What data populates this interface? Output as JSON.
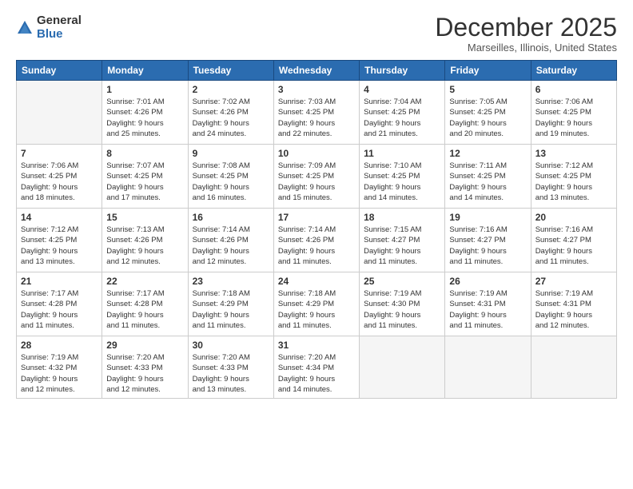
{
  "logo": {
    "general": "General",
    "blue": "Blue"
  },
  "header": {
    "title": "December 2025",
    "location": "Marseilles, Illinois, United States"
  },
  "weekdays": [
    "Sunday",
    "Monday",
    "Tuesday",
    "Wednesday",
    "Thursday",
    "Friday",
    "Saturday"
  ],
  "weeks": [
    [
      {
        "day": "",
        "info": ""
      },
      {
        "day": "1",
        "info": "Sunrise: 7:01 AM\nSunset: 4:26 PM\nDaylight: 9 hours\nand 25 minutes."
      },
      {
        "day": "2",
        "info": "Sunrise: 7:02 AM\nSunset: 4:26 PM\nDaylight: 9 hours\nand 24 minutes."
      },
      {
        "day": "3",
        "info": "Sunrise: 7:03 AM\nSunset: 4:25 PM\nDaylight: 9 hours\nand 22 minutes."
      },
      {
        "day": "4",
        "info": "Sunrise: 7:04 AM\nSunset: 4:25 PM\nDaylight: 9 hours\nand 21 minutes."
      },
      {
        "day": "5",
        "info": "Sunrise: 7:05 AM\nSunset: 4:25 PM\nDaylight: 9 hours\nand 20 minutes."
      },
      {
        "day": "6",
        "info": "Sunrise: 7:06 AM\nSunset: 4:25 PM\nDaylight: 9 hours\nand 19 minutes."
      }
    ],
    [
      {
        "day": "7",
        "info": "Sunrise: 7:06 AM\nSunset: 4:25 PM\nDaylight: 9 hours\nand 18 minutes."
      },
      {
        "day": "8",
        "info": "Sunrise: 7:07 AM\nSunset: 4:25 PM\nDaylight: 9 hours\nand 17 minutes."
      },
      {
        "day": "9",
        "info": "Sunrise: 7:08 AM\nSunset: 4:25 PM\nDaylight: 9 hours\nand 16 minutes."
      },
      {
        "day": "10",
        "info": "Sunrise: 7:09 AM\nSunset: 4:25 PM\nDaylight: 9 hours\nand 15 minutes."
      },
      {
        "day": "11",
        "info": "Sunrise: 7:10 AM\nSunset: 4:25 PM\nDaylight: 9 hours\nand 14 minutes."
      },
      {
        "day": "12",
        "info": "Sunrise: 7:11 AM\nSunset: 4:25 PM\nDaylight: 9 hours\nand 14 minutes."
      },
      {
        "day": "13",
        "info": "Sunrise: 7:12 AM\nSunset: 4:25 PM\nDaylight: 9 hours\nand 13 minutes."
      }
    ],
    [
      {
        "day": "14",
        "info": "Sunrise: 7:12 AM\nSunset: 4:25 PM\nDaylight: 9 hours\nand 13 minutes."
      },
      {
        "day": "15",
        "info": "Sunrise: 7:13 AM\nSunset: 4:26 PM\nDaylight: 9 hours\nand 12 minutes."
      },
      {
        "day": "16",
        "info": "Sunrise: 7:14 AM\nSunset: 4:26 PM\nDaylight: 9 hours\nand 12 minutes."
      },
      {
        "day": "17",
        "info": "Sunrise: 7:14 AM\nSunset: 4:26 PM\nDaylight: 9 hours\nand 11 minutes."
      },
      {
        "day": "18",
        "info": "Sunrise: 7:15 AM\nSunset: 4:27 PM\nDaylight: 9 hours\nand 11 minutes."
      },
      {
        "day": "19",
        "info": "Sunrise: 7:16 AM\nSunset: 4:27 PM\nDaylight: 9 hours\nand 11 minutes."
      },
      {
        "day": "20",
        "info": "Sunrise: 7:16 AM\nSunset: 4:27 PM\nDaylight: 9 hours\nand 11 minutes."
      }
    ],
    [
      {
        "day": "21",
        "info": "Sunrise: 7:17 AM\nSunset: 4:28 PM\nDaylight: 9 hours\nand 11 minutes."
      },
      {
        "day": "22",
        "info": "Sunrise: 7:17 AM\nSunset: 4:28 PM\nDaylight: 9 hours\nand 11 minutes."
      },
      {
        "day": "23",
        "info": "Sunrise: 7:18 AM\nSunset: 4:29 PM\nDaylight: 9 hours\nand 11 minutes."
      },
      {
        "day": "24",
        "info": "Sunrise: 7:18 AM\nSunset: 4:29 PM\nDaylight: 9 hours\nand 11 minutes."
      },
      {
        "day": "25",
        "info": "Sunrise: 7:19 AM\nSunset: 4:30 PM\nDaylight: 9 hours\nand 11 minutes."
      },
      {
        "day": "26",
        "info": "Sunrise: 7:19 AM\nSunset: 4:31 PM\nDaylight: 9 hours\nand 11 minutes."
      },
      {
        "day": "27",
        "info": "Sunrise: 7:19 AM\nSunset: 4:31 PM\nDaylight: 9 hours\nand 12 minutes."
      }
    ],
    [
      {
        "day": "28",
        "info": "Sunrise: 7:19 AM\nSunset: 4:32 PM\nDaylight: 9 hours\nand 12 minutes."
      },
      {
        "day": "29",
        "info": "Sunrise: 7:20 AM\nSunset: 4:33 PM\nDaylight: 9 hours\nand 12 minutes."
      },
      {
        "day": "30",
        "info": "Sunrise: 7:20 AM\nSunset: 4:33 PM\nDaylight: 9 hours\nand 13 minutes."
      },
      {
        "day": "31",
        "info": "Sunrise: 7:20 AM\nSunset: 4:34 PM\nDaylight: 9 hours\nand 14 minutes."
      },
      {
        "day": "",
        "info": ""
      },
      {
        "day": "",
        "info": ""
      },
      {
        "day": "",
        "info": ""
      }
    ]
  ]
}
